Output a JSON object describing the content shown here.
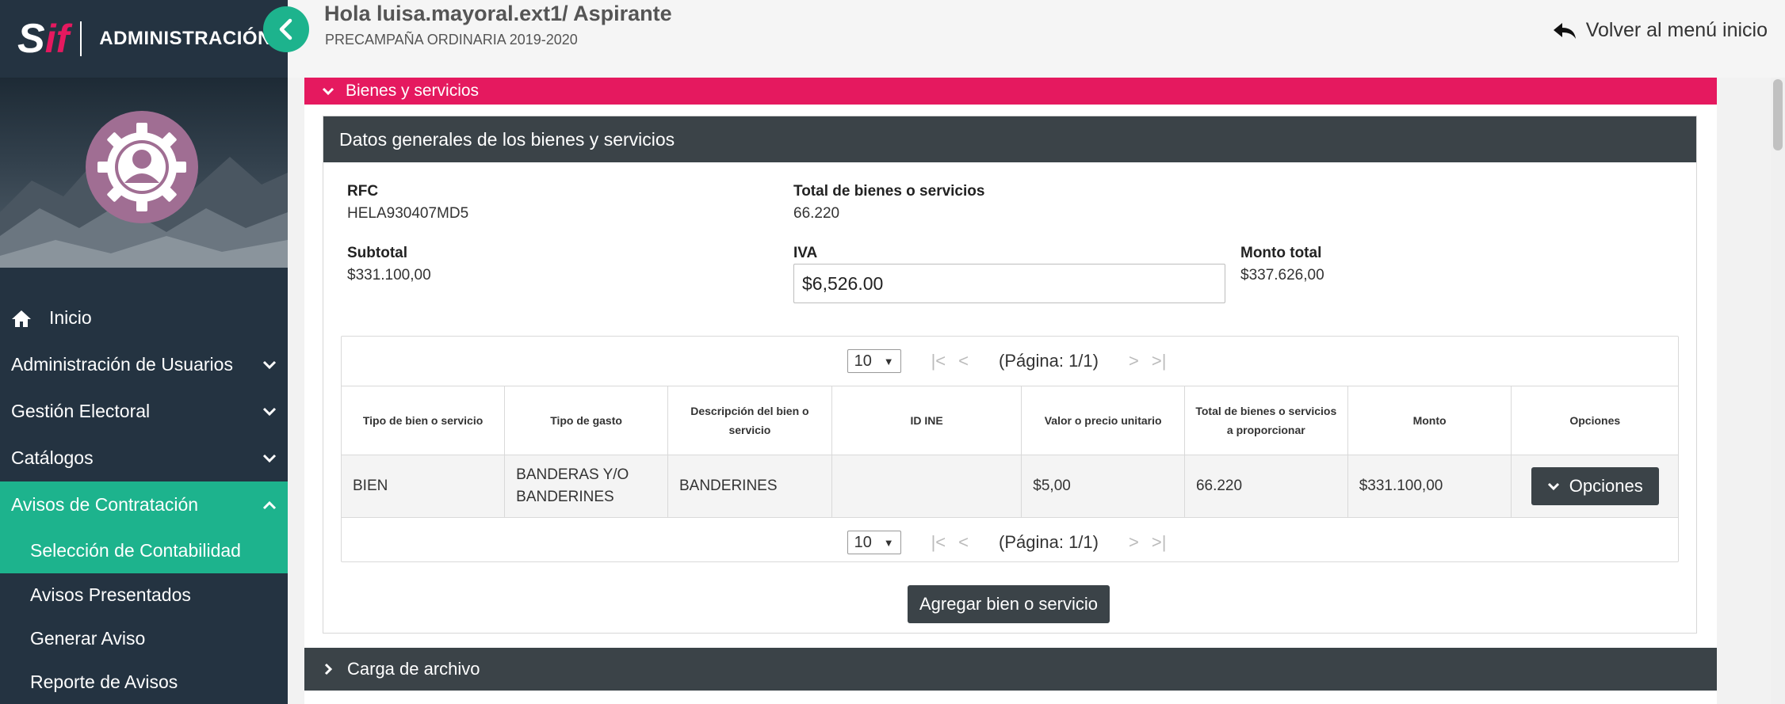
{
  "sidebar": {
    "logo_s": "S",
    "logo_if": "if",
    "title": "ADMINISTRACIÓN",
    "items": [
      {
        "label": "Inicio"
      },
      {
        "label": "Administración de Usuarios"
      },
      {
        "label": "Gestión Electoral"
      },
      {
        "label": "Catálogos"
      },
      {
        "label": "Avisos de Contratación"
      }
    ],
    "subitems": [
      {
        "label": "Selección de Contabilidad"
      },
      {
        "label": "Avisos Presentados"
      },
      {
        "label": "Generar Aviso"
      },
      {
        "label": "Reporte de Avisos"
      }
    ]
  },
  "header": {
    "greeting": "Hola luisa.mayoral.ext1/ Aspirante",
    "process": "PRECAMPAÑA ORDINARIA 2019-2020",
    "back_label": "Volver al menú inicio"
  },
  "section": {
    "title": "Bienes y servicios",
    "card_title": "Datos generales de los bienes y servicios"
  },
  "fields": {
    "rfc_label": "RFC",
    "rfc_value": "HELA930407MD5",
    "total_label": "Total de bienes o servicios",
    "total_value": "66.220",
    "subtotal_label": "Subtotal",
    "subtotal_value": "$331.100,00",
    "iva_label": "IVA",
    "iva_value": "$6,526.00",
    "monto_label": "Monto total",
    "monto_value": "$337.626,00"
  },
  "pager": {
    "page_size": "10",
    "page_label": "(Página: 1/1)"
  },
  "table": {
    "headers": [
      "Tipo de bien o servicio",
      "Tipo de gasto",
      "Descripción del bien o servicio",
      "ID INE",
      "Valor o precio unitario",
      "Total de bienes o servicios a proporcionar",
      "Monto",
      "Opciones"
    ],
    "rows": [
      {
        "tipo_bien": "BIEN",
        "tipo_gasto": "BANDERAS Y/O BANDERINES",
        "descripcion": "BANDERINES",
        "id_ine": "",
        "valor": "$5,00",
        "total": "66.220",
        "monto": "$331.100,00",
        "opciones": "Opciones"
      }
    ]
  },
  "buttons": {
    "add": "Agregar bien o servicio"
  },
  "section2": {
    "title": "Carga de archivo"
  },
  "colors": {
    "sidebar_bg": "#243341",
    "accent_green": "#1db38d",
    "accent_pink": "#e5195f",
    "dark_gray": "#3b4348"
  },
  "icons": {
    "collapse": "chevron-left-icon",
    "home": "home-icon",
    "back": "reply-arrow-icon",
    "expand": "chevron-down-icon",
    "collapsed": "chevron-right-icon"
  }
}
